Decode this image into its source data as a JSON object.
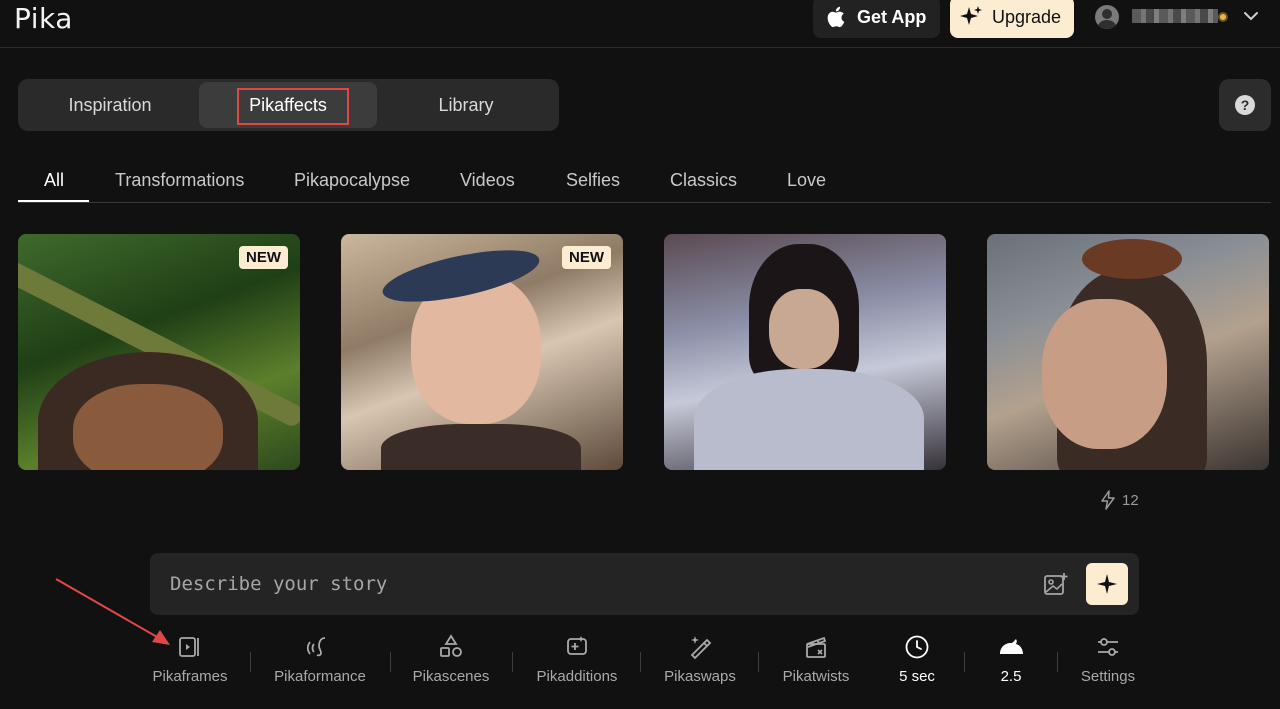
{
  "header": {
    "logo": "Pika",
    "get_app_label": "Get App",
    "upgrade_label": "Upgrade"
  },
  "main_tabs": [
    {
      "label": "Inspiration",
      "active": false
    },
    {
      "label": "Pikaffects",
      "active": true
    },
    {
      "label": "Library",
      "active": false
    }
  ],
  "help_label": "?",
  "categories": [
    "All",
    "Transformations",
    "Pikapocalypse",
    "Videos",
    "Selfies",
    "Classics",
    "Love"
  ],
  "active_category": "All",
  "cards": [
    {
      "badge": "NEW"
    },
    {
      "badge": "NEW"
    },
    {
      "badge": ""
    },
    {
      "badge": ""
    }
  ],
  "likes_count": "12",
  "prompt": {
    "placeholder": "Describe your story",
    "value": ""
  },
  "toolbar": {
    "pikaframes": "Pikaframes",
    "pikaformance": "Pikaformance",
    "pikascenes": "Pikascenes",
    "pikadditions": "Pikadditions",
    "pikaswaps": "Pikaswaps",
    "pikatwists": "Pikatwists",
    "duration": "5 sec",
    "model": "2.5",
    "settings": "Settings"
  },
  "colors": {
    "background": "#111111",
    "accent_cream": "#fbecd2",
    "annotation_red": "#e04848"
  }
}
